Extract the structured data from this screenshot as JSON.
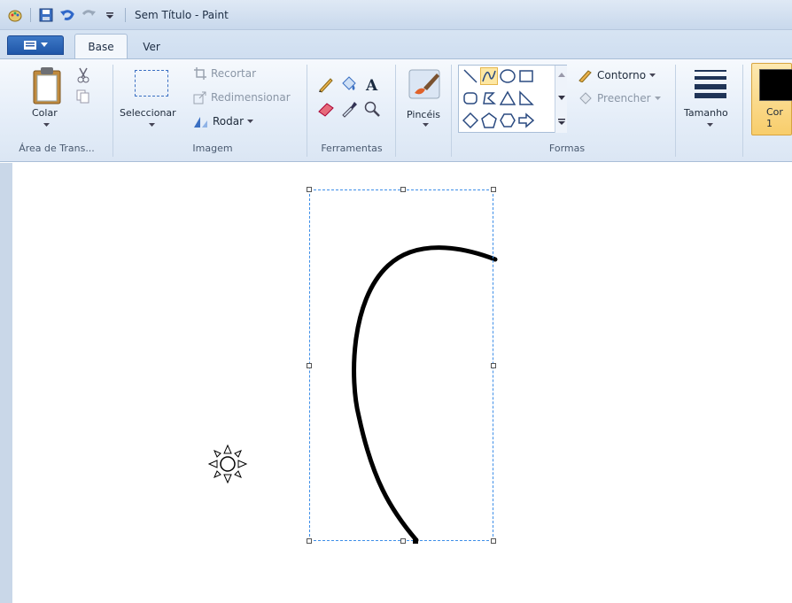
{
  "window": {
    "title": "Sem Título - Paint"
  },
  "tabs": [
    {
      "label": "Base",
      "active": true
    },
    {
      "label": "Ver",
      "active": false
    }
  ],
  "clipboard": {
    "paste_label": "Colar",
    "group_label": "Área de Trans..."
  },
  "image": {
    "select_label": "Seleccionar",
    "crop_label": "Recortar",
    "resize_label": "Redimensionar",
    "rotate_label": "Rodar",
    "group_label": "Imagem"
  },
  "tools": {
    "group_label": "Ferramentas"
  },
  "brushes": {
    "label": "Pincéis"
  },
  "shapes": {
    "outline_label": "Contorno",
    "fill_label": "Preencher",
    "group_label": "Formas",
    "selected": "curve"
  },
  "size": {
    "label": "Tamanho"
  },
  "color1": {
    "label": "Cor 1",
    "value": "#000000"
  },
  "colors": {
    "accent_selection": "#3d8ee8",
    "ribbon": "#dbe6f4"
  }
}
